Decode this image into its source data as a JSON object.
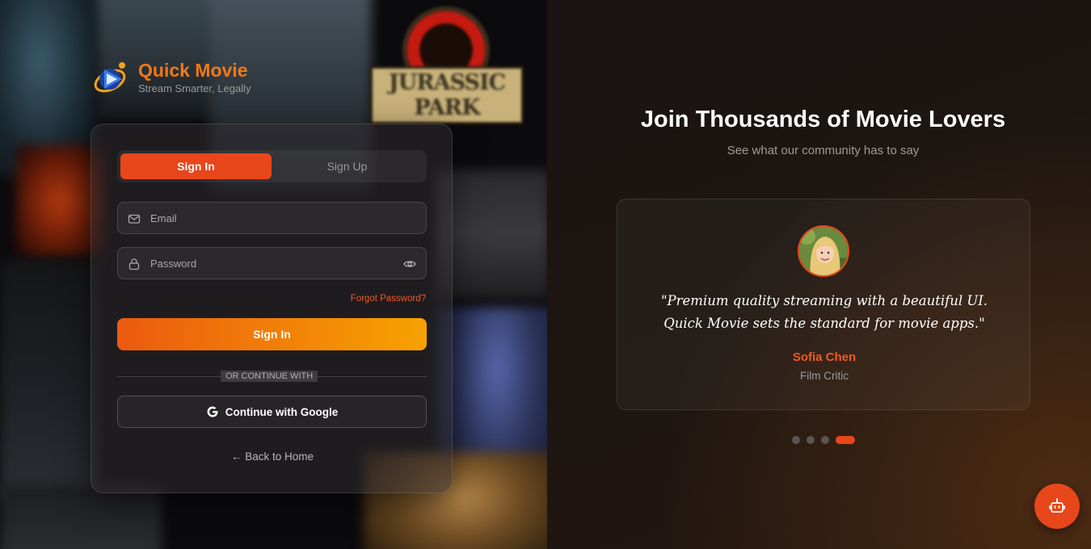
{
  "brand": {
    "title": "Quick Movie",
    "tagline": "Stream Smarter, Legally",
    "accent": "#f07818"
  },
  "background": {
    "poster_logo_text": "JURASSIC PARK"
  },
  "auth": {
    "tabs": [
      {
        "label": "Sign In",
        "active": true
      },
      {
        "label": "Sign Up",
        "active": false
      }
    ],
    "email": {
      "placeholder": "Email",
      "value": "",
      "icon": "mail-icon"
    },
    "password": {
      "placeholder": "Password",
      "value": "",
      "icon": "lock-icon",
      "toggle_icon": "eye-icon"
    },
    "forgot_label": "Forgot Password?",
    "submit_label": "Sign In",
    "divider_label": "OR CONTINUE WITH",
    "google_label": "Continue with Google",
    "back_label": "← Back to Home",
    "primary_color": "#e8461b"
  },
  "testimonials": {
    "heading": "Join Thousands of Movie Lovers",
    "subheading": "See what our community has to say",
    "current": {
      "quote": "\"Premium quality streaming with a beautiful UI. Quick Movie sets the standard for movie apps.\"",
      "name": "Sofia Chen",
      "role": "Film Critic"
    },
    "pagination": {
      "total": 4,
      "active_index": 3
    }
  },
  "chatbot": {
    "icon": "robot-icon"
  }
}
